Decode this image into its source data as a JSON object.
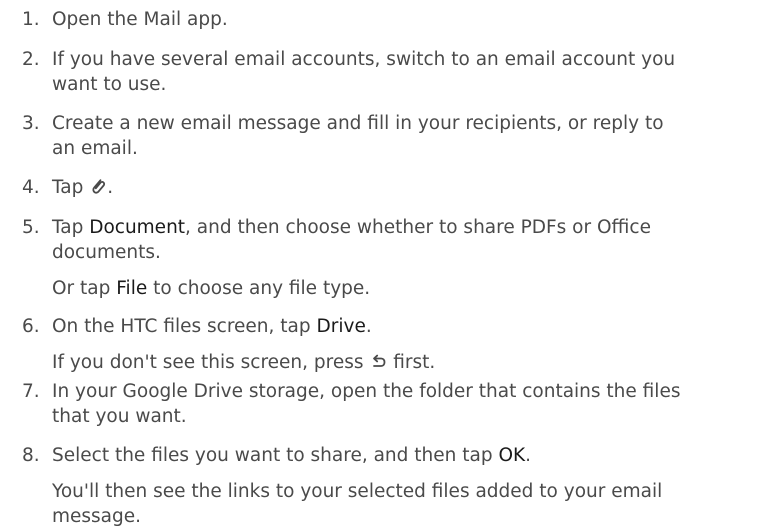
{
  "steps": [
    {
      "num": "1.",
      "lines": [
        "Open the Mail app."
      ]
    },
    {
      "num": "2.",
      "lines": [
        "If you have several email accounts, switch to an email account you",
        "want to use."
      ]
    },
    {
      "num": "3.",
      "lines": [
        "Create a new email message and fill in your recipients, or reply to",
        "an email."
      ]
    },
    {
      "num": "4.",
      "pre": "Tap ",
      "icon": "paperclip-icon",
      "post": "."
    },
    {
      "num": "5.",
      "line1_pre": "Tap ",
      "line1_em": "Document",
      "line1_post": ", and then choose whether to share PDFs or Office",
      "line2": "documents.",
      "note_pre": "Or tap ",
      "note_em": "File",
      "note_post": " to choose any file type."
    },
    {
      "num": "6.",
      "pre": "On the HTC files screen, tap ",
      "em": "Drive",
      "post": ".",
      "note_pre": "If you don't see this screen, press ",
      "note_icon": "back-arrow-icon",
      "note_post": " first."
    },
    {
      "num": "7.",
      "lines": [
        "In your Google Drive storage, open the folder that contains the files",
        "that you want."
      ]
    },
    {
      "num": "8.",
      "pre": "Select the files you want to share, and then tap ",
      "em": "OK",
      "post": ".",
      "note_lines": [
        "You'll then see the links to your selected files added to your email",
        "message."
      ]
    }
  ]
}
